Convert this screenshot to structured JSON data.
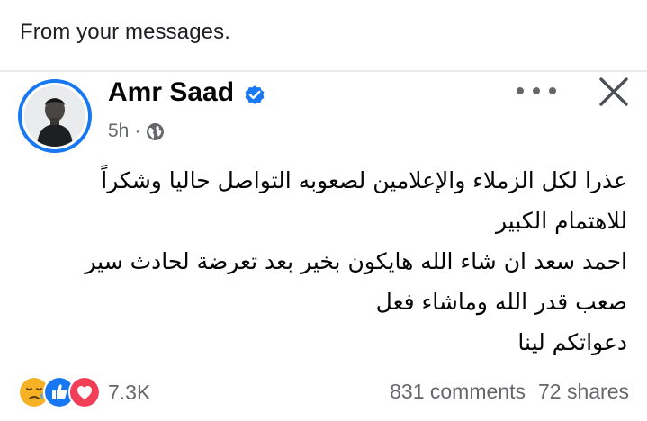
{
  "context": {
    "label": "From your messages."
  },
  "post": {
    "author": "Amr Saad",
    "verified": true,
    "time": "5h",
    "separator": "·",
    "audience_icon": "globe-icon",
    "lines": [
      "عذرا لكل الزملاء والإعلامين لصعوبه التواصل حاليا  وشكراً",
      "للاهتمام الكبير",
      "احمد سعد ان شاء الله هايكون بخير بعد تعرضة لحادث سير",
      "صعب قدر الله وماشاء فعل",
      "دعواتكم لينا"
    ]
  },
  "reactions": {
    "icons": [
      "care-reaction-icon",
      "like-reaction-icon",
      "love-reaction-icon"
    ],
    "count": "7.3K"
  },
  "engagement": {
    "comments": "831 comments",
    "shares": "72 shares"
  },
  "colors": {
    "accent": "#1877f2",
    "love": "#f33e58",
    "care": "#f7b125",
    "secondary_text": "#65676b"
  }
}
